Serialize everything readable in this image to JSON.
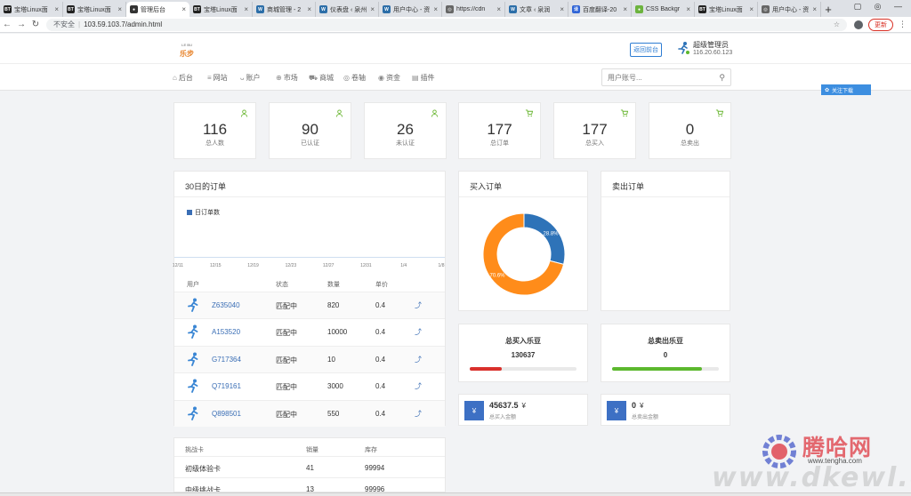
{
  "browser": {
    "tabs": [
      {
        "title": "宝塔Linux面",
        "favicon": "BT",
        "color": "#222"
      },
      {
        "title": "宝塔Linux面",
        "favicon": "BT",
        "color": "#222"
      },
      {
        "title": "管理后台",
        "favicon": "●",
        "color": "#333",
        "active": true
      },
      {
        "title": "宝塔Linux面",
        "favicon": "BT",
        "color": "#222"
      },
      {
        "title": "商城管理 - 2",
        "favicon": "W",
        "color": "#2c6ea8"
      },
      {
        "title": "仪表盘 ‹ 泉州",
        "favicon": "W",
        "color": "#2c6ea8"
      },
      {
        "title": "用户中心 - 资",
        "favicon": "W",
        "color": "#2c6ea8"
      },
      {
        "title": "https://cdn",
        "favicon": "◎",
        "color": "#666"
      },
      {
        "title": "文章 ‹ 泉润",
        "favicon": "W",
        "color": "#2c6ea8"
      },
      {
        "title": "百度翻译-20",
        "favicon": "译",
        "color": "#2f64d6"
      },
      {
        "title": "CSS Backgr",
        "favicon": "●",
        "color": "#6cb33e"
      },
      {
        "title": "宝塔Linux面",
        "favicon": "BT",
        "color": "#222"
      },
      {
        "title": "用户中心 - 资",
        "favicon": "◎",
        "color": "#666"
      }
    ],
    "insecure_label": "不安全",
    "url": "103.59.103.7/admin.html",
    "update_label": "更新"
  },
  "header": {
    "logo_text": "乐步",
    "logo_sub": "LE BU",
    "back_home": "返回前台",
    "admin_name": "超级管理员",
    "admin_ip": "116.20.60.123"
  },
  "nav": {
    "items": [
      {
        "label": "后台",
        "icon": "⌂"
      },
      {
        "label": "网站",
        "icon": "≡"
      },
      {
        "label": "账户",
        "icon": "ᴗ"
      },
      {
        "label": "市场",
        "icon": "⊕"
      },
      {
        "label": "商城",
        "icon": "⛟"
      },
      {
        "label": "卷轴",
        "icon": "◎"
      },
      {
        "label": "资金",
        "icon": "◉"
      },
      {
        "label": "插件",
        "icon": "▤"
      }
    ],
    "search_placeholder": "用户账号...",
    "qr_label": "关注下载"
  },
  "stats": [
    {
      "value": "116",
      "label": "总人数",
      "icon": "person-icon"
    },
    {
      "value": "90",
      "label": "已认证",
      "icon": "person-icon"
    },
    {
      "value": "26",
      "label": "未认证",
      "icon": "person-icon"
    },
    {
      "value": "177",
      "label": "总订单",
      "icon": "cart-icon"
    },
    {
      "value": "177",
      "label": "总买入",
      "icon": "cart-icon"
    },
    {
      "value": "0",
      "label": "总卖出",
      "icon": "cart-icon"
    }
  ],
  "orders_panel": {
    "title": "30日的订单",
    "legend": "日订单数",
    "columns": [
      "用户",
      "状态",
      "数量",
      "单价"
    ],
    "rows": [
      {
        "user": "Z635040",
        "status": "匹配中",
        "qty": "820",
        "price": "0.4"
      },
      {
        "user": "A153520",
        "status": "匹配中",
        "qty": "10000",
        "price": "0.4"
      },
      {
        "user": "G717364",
        "status": "匹配中",
        "qty": "10",
        "price": "0.4"
      },
      {
        "user": "Q719161",
        "status": "匹配中",
        "qty": "3000",
        "price": "0.4"
      },
      {
        "user": "Q898501",
        "status": "匹配中",
        "qty": "550",
        "price": "0.4"
      }
    ]
  },
  "chart_data": [
    {
      "type": "line",
      "title": "30日的订单",
      "series": [
        {
          "name": "日订单数",
          "values": []
        }
      ],
      "x_ticks": [
        "12/11",
        "12/15",
        "12/19",
        "12/23",
        "12/27",
        "12/31",
        "1/4",
        "1/8"
      ],
      "grid": false,
      "legend": "top-left"
    },
    {
      "type": "pie",
      "title": "买入订单",
      "slices": [
        {
          "label": "28.8%",
          "value": 28.8,
          "color": "#2e73b8"
        },
        {
          "label": "70.6%",
          "value": 70.6,
          "color": "#ff8c1a"
        }
      ]
    }
  ],
  "buy_panel": {
    "title": "买入订单"
  },
  "sell_panel": {
    "title": "卖出订单"
  },
  "totals": {
    "buy_title": "总买入乐豆",
    "buy_value": "130637",
    "buy_progress": 0.3,
    "sell_title": "总卖出乐豆",
    "sell_value": "0",
    "sell_progress": 0.84,
    "colors": {
      "buy": "#d9302c",
      "sell": "#5cb82e"
    }
  },
  "money": {
    "buy_amount": "45637.5",
    "buy_unit": "¥",
    "buy_label": "总买入金额",
    "sell_amount": "0",
    "sell_unit": "¥",
    "sell_label": "总卖出金额",
    "icon": "¥"
  },
  "challenge": {
    "columns": [
      "挑战卡",
      "销量",
      "库存"
    ],
    "rows": [
      {
        "name": "初级体验卡",
        "sales": "41",
        "stock": "99994"
      },
      {
        "name": "中级挑战卡",
        "sales": "13",
        "stock": "99996"
      }
    ]
  },
  "watermark": {
    "cn": "腾哈网",
    "site": "www.tengha.com",
    "big": "www.dkewl.com"
  }
}
